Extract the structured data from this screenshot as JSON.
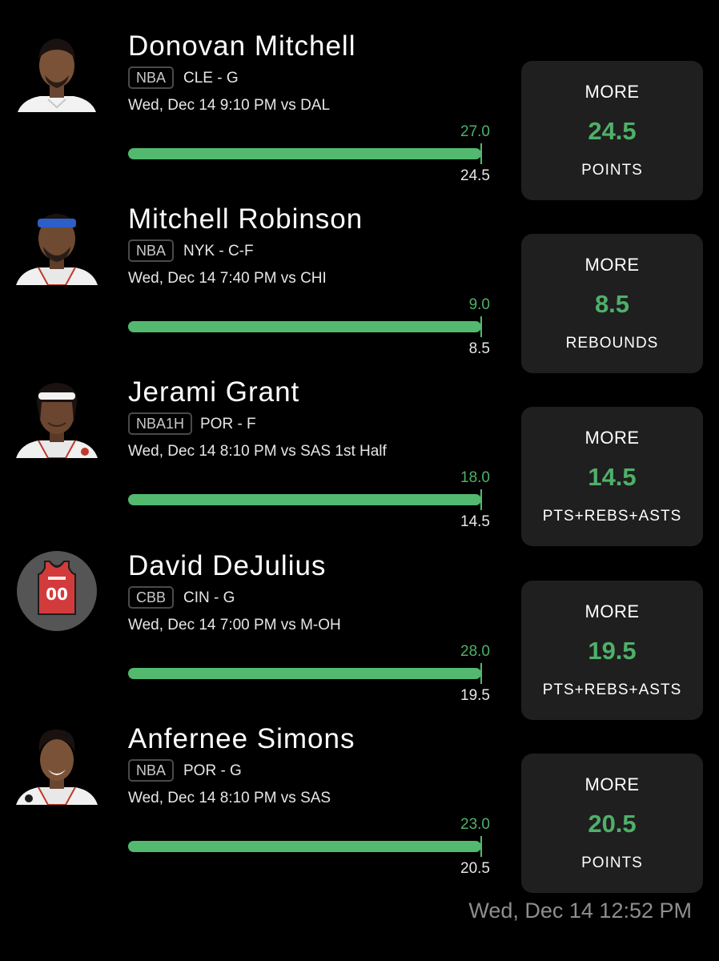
{
  "picks": [
    {
      "player": "Donovan Mitchell",
      "league": "NBA",
      "team_pos": "CLE - G",
      "game": "Wed, Dec 14 9:10 PM  vs DAL",
      "actual": "27.0",
      "line_label": "24.5",
      "progress": 1.0,
      "direction": "MORE",
      "line": "24.5",
      "stat": "POINTS",
      "avatar": "player-headshot-white-jersey"
    },
    {
      "player": "Mitchell Robinson",
      "league": "NBA",
      "team_pos": "NYK - C-F",
      "game": "Wed, Dec 14 7:40 PM  vs CHI",
      "actual": "9.0",
      "line_label": "8.5",
      "progress": 1.0,
      "direction": "MORE",
      "line": "8.5",
      "stat": "REBOUNDS",
      "avatar": "player-headshot-headband"
    },
    {
      "player": "Jerami Grant",
      "league": "NBA1H",
      "team_pos": "POR - F",
      "game": "Wed, Dec 14 8:10 PM  vs SAS 1st Half",
      "actual": "18.0",
      "line_label": "14.5",
      "progress": 1.0,
      "direction": "MORE",
      "line": "14.5",
      "stat": "PTS+REBS+ASTS",
      "avatar": "player-headshot-headband"
    },
    {
      "player": "David DeJulius",
      "league": "CBB",
      "team_pos": "CIN - G",
      "game": "Wed, Dec 14 7:00 PM  vs M-OH",
      "actual": "28.0",
      "line_label": "19.5",
      "progress": 1.0,
      "direction": "MORE",
      "line": "19.5",
      "stat": "PTS+REBS+ASTS",
      "avatar": "jersey-placeholder",
      "jersey_number": "00"
    },
    {
      "player": "Anfernee Simons",
      "league": "NBA",
      "team_pos": "POR - G",
      "game": "Wed, Dec 14 8:10 PM  vs SAS",
      "actual": "23.0",
      "line_label": "20.5",
      "progress": 1.0,
      "direction": "MORE",
      "line": "20.5",
      "stat": "POINTS",
      "avatar": "player-headshot-white-jersey"
    }
  ],
  "timestamp": "Wed, Dec 14 12:52 PM",
  "colors": {
    "background": "#000000",
    "accent_green": "#52b96e",
    "card_bg": "#1f1f1f",
    "muted_text": "#8e8e8e",
    "jersey_red": "#d23b3b"
  }
}
